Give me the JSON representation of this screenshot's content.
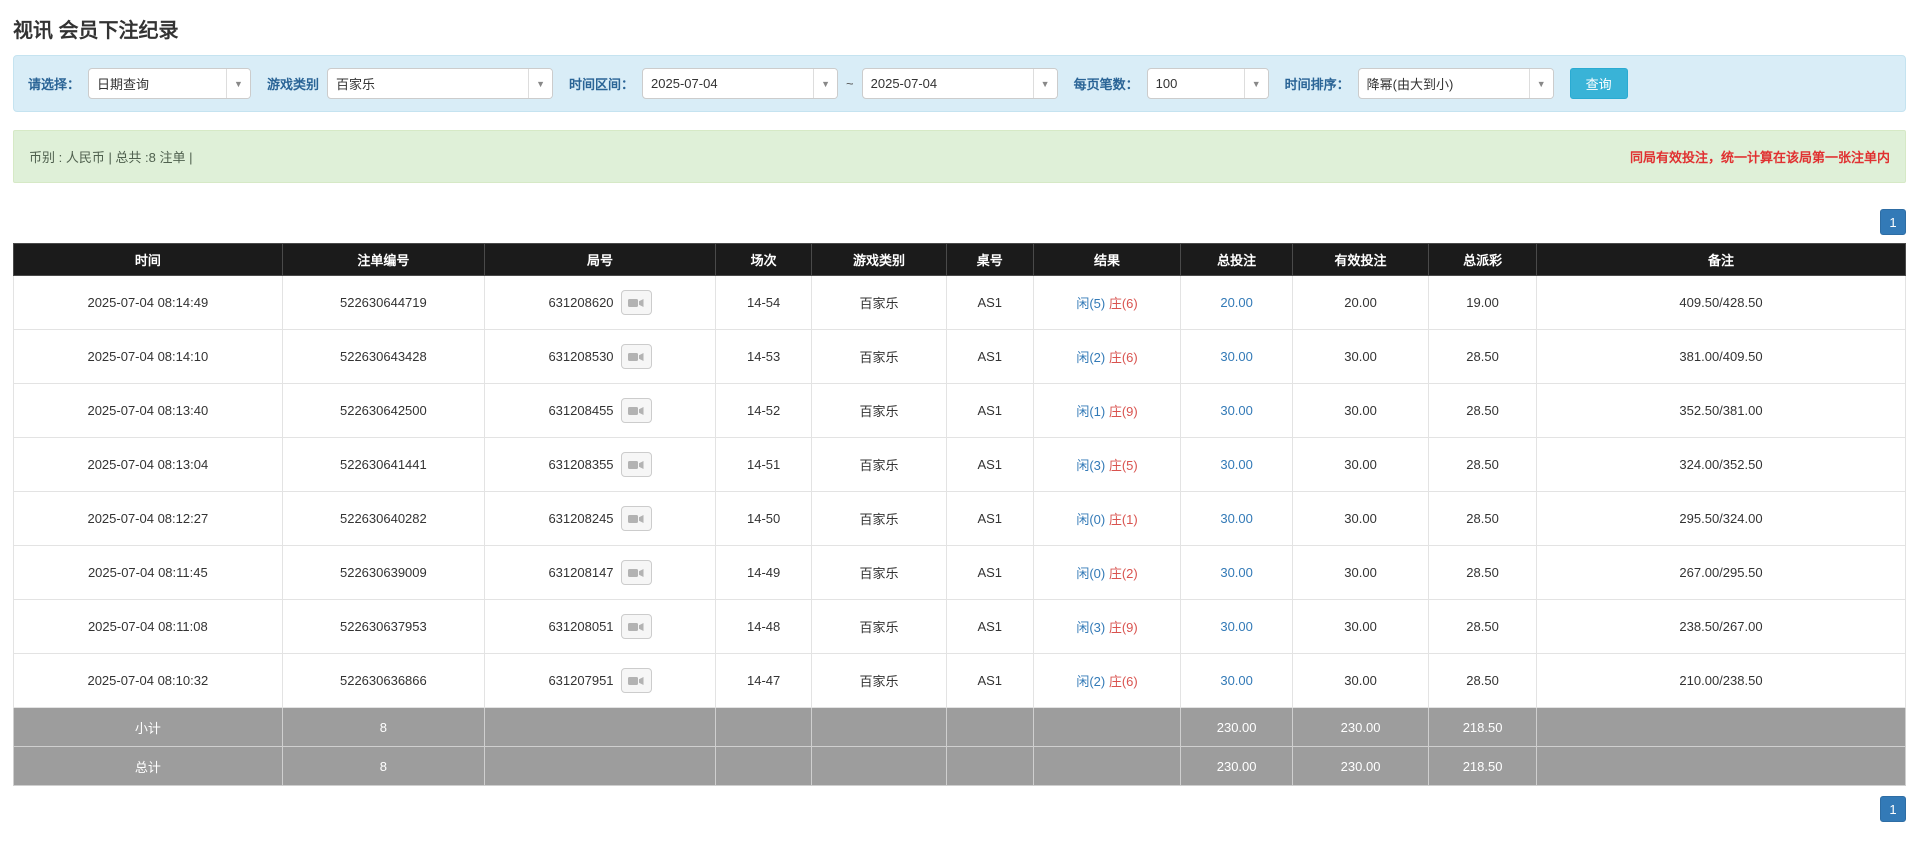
{
  "page": {
    "title": "视讯 会员下注纪录"
  },
  "filters": {
    "select_label": "请选择：",
    "select_value": "日期查询",
    "game_type_label": "游戏类别",
    "game_type_value": "百家乐",
    "time_range_label": "时间区间：",
    "date_from": "2025-07-04",
    "range_separator": "~",
    "date_to": "2025-07-04",
    "page_size_label": "每页笔数：",
    "page_size_value": "100",
    "sort_label": "时间排序：",
    "sort_value": "降幂(由大到小)",
    "search_button": "查询"
  },
  "summary": {
    "left": "币别 : 人民币 | 总共 :8 注单 |",
    "right": "同局有效投注，统一计算在该局第一张注单内"
  },
  "pagination": {
    "page": "1"
  },
  "colors": {
    "accent_blue": "#337ab7",
    "banker_red": "#d9534f",
    "header_black": "#1b1b1b",
    "footer_gray": "#9d9d9d"
  },
  "table": {
    "headers": [
      "时间",
      "注单编号",
      "局号",
      "场次",
      "游戏类别",
      "桌号",
      "结果",
      "总投注",
      "有效投注",
      "总派彩",
      "备注"
    ],
    "rows": [
      {
        "time": "2025-07-04 08:14:49",
        "bet_id": "522630644719",
        "round_id": "631208620",
        "session": "14-54",
        "game": "百家乐",
        "table_no": "AS1",
        "result_player": "闲(5)",
        "result_banker": "庄(6)",
        "total_bet": "20.00",
        "valid_bet": "20.00",
        "payout": "19.00",
        "remark": "409.50/428.50"
      },
      {
        "time": "2025-07-04 08:14:10",
        "bet_id": "522630643428",
        "round_id": "631208530",
        "session": "14-53",
        "game": "百家乐",
        "table_no": "AS1",
        "result_player": "闲(2)",
        "result_banker": "庄(6)",
        "total_bet": "30.00",
        "valid_bet": "30.00",
        "payout": "28.50",
        "remark": "381.00/409.50"
      },
      {
        "time": "2025-07-04 08:13:40",
        "bet_id": "522630642500",
        "round_id": "631208455",
        "session": "14-52",
        "game": "百家乐",
        "table_no": "AS1",
        "result_player": "闲(1)",
        "result_banker": "庄(9)",
        "total_bet": "30.00",
        "valid_bet": "30.00",
        "payout": "28.50",
        "remark": "352.50/381.00"
      },
      {
        "time": "2025-07-04 08:13:04",
        "bet_id": "522630641441",
        "round_id": "631208355",
        "session": "14-51",
        "game": "百家乐",
        "table_no": "AS1",
        "result_player": "闲(3)",
        "result_banker": "庄(5)",
        "total_bet": "30.00",
        "valid_bet": "30.00",
        "payout": "28.50",
        "remark": "324.00/352.50"
      },
      {
        "time": "2025-07-04 08:12:27",
        "bet_id": "522630640282",
        "round_id": "631208245",
        "session": "14-50",
        "game": "百家乐",
        "table_no": "AS1",
        "result_player": "闲(0)",
        "result_banker": "庄(1)",
        "total_bet": "30.00",
        "valid_bet": "30.00",
        "payout": "28.50",
        "remark": "295.50/324.00"
      },
      {
        "time": "2025-07-04 08:11:45",
        "bet_id": "522630639009",
        "round_id": "631208147",
        "session": "14-49",
        "game": "百家乐",
        "table_no": "AS1",
        "result_player": "闲(0)",
        "result_banker": "庄(2)",
        "total_bet": "30.00",
        "valid_bet": "30.00",
        "payout": "28.50",
        "remark": "267.00/295.50"
      },
      {
        "time": "2025-07-04 08:11:08",
        "bet_id": "522630637953",
        "round_id": "631208051",
        "session": "14-48",
        "game": "百家乐",
        "table_no": "AS1",
        "result_player": "闲(3)",
        "result_banker": "庄(9)",
        "total_bet": "30.00",
        "valid_bet": "30.00",
        "payout": "28.50",
        "remark": "238.50/267.00"
      },
      {
        "time": "2025-07-04 08:10:32",
        "bet_id": "522630636866",
        "round_id": "631207951",
        "session": "14-47",
        "game": "百家乐",
        "table_no": "AS1",
        "result_player": "闲(2)",
        "result_banker": "庄(6)",
        "total_bet": "30.00",
        "valid_bet": "30.00",
        "payout": "28.50",
        "remark": "210.00/238.50"
      }
    ],
    "subtotal": {
      "label": "小计",
      "count": "8",
      "total_bet": "230.00",
      "valid_bet": "230.00",
      "payout": "218.50"
    },
    "total": {
      "label": "总计",
      "count": "8",
      "total_bet": "230.00",
      "valid_bet": "230.00",
      "payout": "218.50"
    }
  }
}
